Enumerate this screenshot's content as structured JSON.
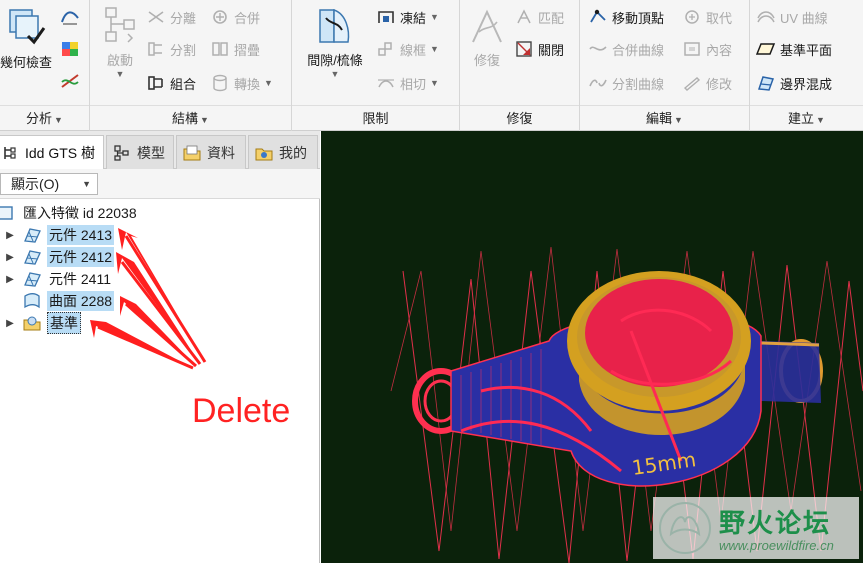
{
  "ribbon": {
    "groups": [
      {
        "label": "分析"
      },
      {
        "label": "結構"
      },
      {
        "label": "限制"
      },
      {
        "label": "修復"
      },
      {
        "label": "編輯"
      },
      {
        "label": "建立"
      }
    ],
    "analysis": {
      "geometry_check": "幾何檢查"
    },
    "structure": {
      "activate": "啟動",
      "separate": "分離",
      "split": "分割",
      "combine": "組合",
      "merge": "合併",
      "fold": "摺疊",
      "convert": "轉換"
    },
    "constraints": {
      "gap_comb": "間隙/梳條",
      "freeze": "凍結",
      "wire_frame": "線框",
      "tangent": "相切"
    },
    "repair": {
      "repair": "修復",
      "match": "匹配",
      "close": "關閉"
    },
    "edit": {
      "move_vertex": "移動頂點",
      "replace": "取代",
      "merge_curves": "合併曲線",
      "inner_face": "內容",
      "split_curves": "分割曲線",
      "modify": "修改"
    },
    "create": {
      "uv_curves": "UV 曲線",
      "datum_plane": "基準平面",
      "boundary_blend": "邊界混成"
    }
  },
  "panel": {
    "tabs": [
      {
        "label": "Idd GTS 樹"
      },
      {
        "label": "模型"
      },
      {
        "label": "資料"
      },
      {
        "label": "我的"
      }
    ],
    "show_button": "顯示(O)",
    "tree": [
      {
        "label": "匯入特徵 id 22038"
      },
      {
        "label": "元件 2413"
      },
      {
        "label": "元件 2412"
      },
      {
        "label": "元件 2411"
      },
      {
        "label": "曲面 2288"
      },
      {
        "label": "基準"
      }
    ]
  },
  "annotation": {
    "text": "Delete",
    "color": "#ff2222"
  },
  "viewport": {
    "background": "#0b220b",
    "model_text": "15mm"
  },
  "watermark": {
    "title": "野火论坛",
    "url": "www.proewildfire.cn"
  },
  "colors": {
    "selection": "#b8dcf5",
    "ribbon_bg": "#f5f5f5",
    "accent_red": "#ff2222"
  }
}
